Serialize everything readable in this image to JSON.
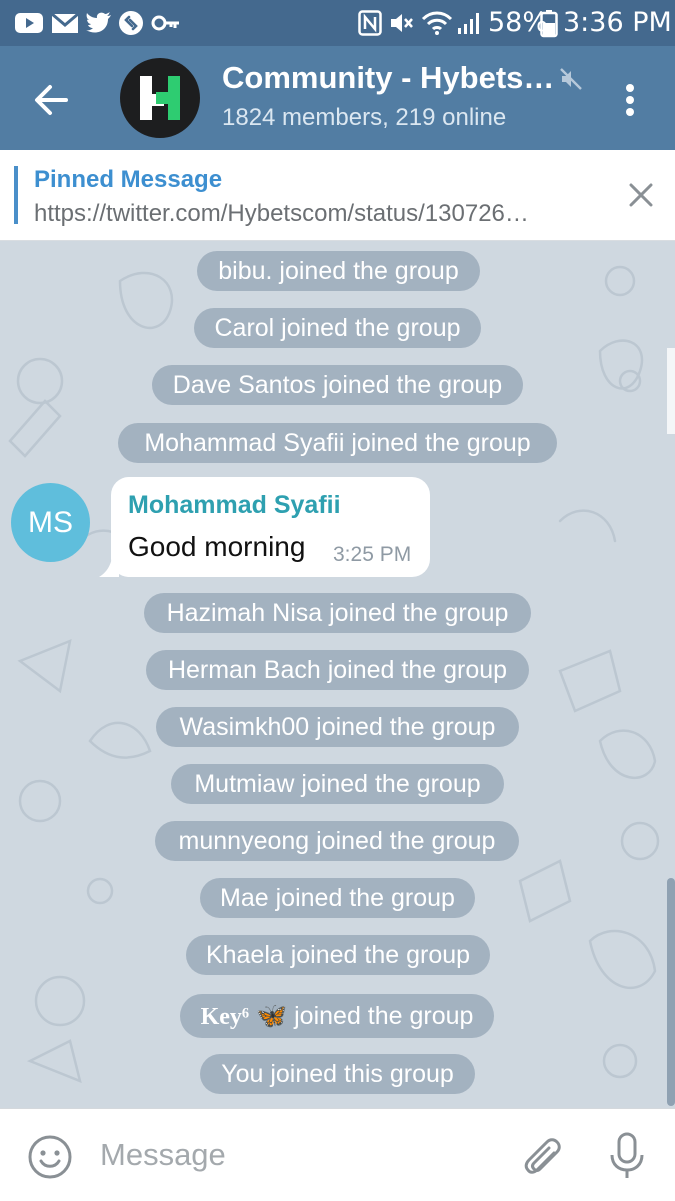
{
  "status_bar": {
    "battery": "58%",
    "time": "3:36 PM",
    "left_icons": [
      "youtube-icon",
      "gmail-icon",
      "twitter-icon",
      "shazam-icon",
      "key-icon"
    ],
    "right_icons": [
      "nfc-icon",
      "vibrate-icon",
      "wifi-icon",
      "signal-icon",
      "battery-icon"
    ]
  },
  "header": {
    "title": "Community - Hybets…",
    "subtitle": "1824 members, 219 online",
    "muted": true,
    "accent_color": "#527da3"
  },
  "pinned": {
    "label": "Pinned Message",
    "text": "https://twitter.com/Hybetscom/status/130726…"
  },
  "messages": {
    "joins_before": [
      "bibu. joined the group",
      "Carol joined the group",
      "Dave Santos joined the group",
      "Mohammad Syafii joined the group"
    ],
    "chat_message": {
      "avatar_initials": "MS",
      "avatar_color": "#5fbedc",
      "sender": "Mohammad Syafii",
      "text": "Good morning",
      "time": "3:25 PM"
    },
    "joins_after": [
      "Hazimah Nisa joined the group",
      "Herman Bach joined the group",
      "Wasimkh00 joined the group",
      "Mutmiaw joined the group",
      "munnyeong joined the group",
      "Mae joined the group",
      "Khaela joined the group"
    ],
    "key_join": {
      "name": "Key⁶",
      "emoji": "🦋",
      "suffix": "joined the group"
    },
    "you_joined": "You joined this group"
  },
  "input": {
    "placeholder": "Message"
  }
}
